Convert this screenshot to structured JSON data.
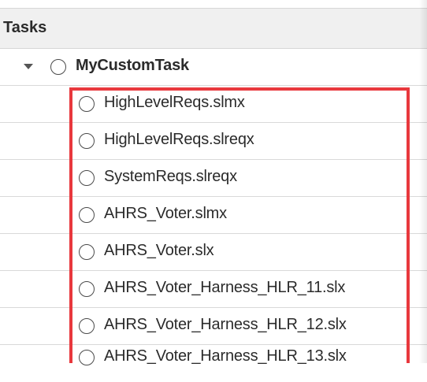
{
  "panel": {
    "header": {
      "title": "Tasks"
    },
    "root": {
      "label": "MyCustomTask",
      "expanded": true,
      "children": [
        {
          "label": "HighLevelReqs.slmx"
        },
        {
          "label": "HighLevelReqs.slreqx"
        },
        {
          "label": "SystemReqs.slreqx"
        },
        {
          "label": "AHRS_Voter.slmx"
        },
        {
          "label": "AHRS_Voter.slx"
        },
        {
          "label": "AHRS_Voter_Harness_HLR_11.slx"
        },
        {
          "label": "AHRS_Voter_Harness_HLR_12.slx"
        },
        {
          "label": "AHRS_Voter_Harness_HLR_13.slx"
        }
      ]
    }
  },
  "colors": {
    "highlight_border": "#e8383d",
    "header_bg": "#f0f0f0"
  },
  "icons": {
    "expand": "chevron-down-icon",
    "status": "circle-status-icon"
  }
}
